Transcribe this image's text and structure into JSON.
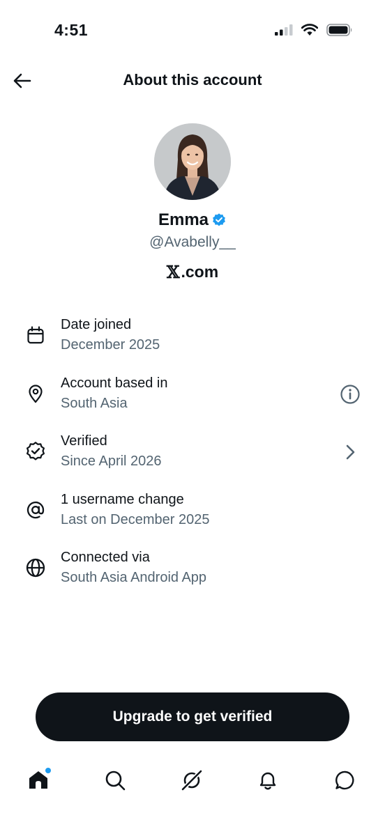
{
  "status_bar": {
    "time": "4:51"
  },
  "header": {
    "title": "About this account"
  },
  "profile": {
    "display_name": "Emma",
    "handle": "@Avabelly__",
    "source_x": "𝕏",
    "source_domain": ".com",
    "verified_color": "#1d9bf0"
  },
  "info_rows": [
    {
      "icon": "calendar-icon",
      "title": "Date joined",
      "subtitle": "December 2025"
    },
    {
      "icon": "location-pin-icon",
      "title": "Account based in",
      "subtitle": "South Asia",
      "trailing": "info-icon"
    },
    {
      "icon": "verified-badge-icon",
      "title": "Verified",
      "subtitle": "Since April 2026",
      "trailing": "chevron-right-icon"
    },
    {
      "icon": "at-sign-icon",
      "title": "1 username change",
      "subtitle": "Last on December 2025"
    },
    {
      "icon": "globe-icon",
      "title": "Connected via",
      "subtitle": "South Asia Android App"
    }
  ],
  "upgrade_button": {
    "label": "Upgrade to get verified"
  },
  "bottom_nav": {
    "items": [
      "home-icon",
      "search-icon",
      "grok-icon",
      "notifications-icon",
      "messages-icon"
    ],
    "home_unread": true
  },
  "colors": {
    "primary_text": "#0f1419",
    "secondary_text": "#536471",
    "accent": "#1d9bf0",
    "button_bg": "#0f1419"
  }
}
